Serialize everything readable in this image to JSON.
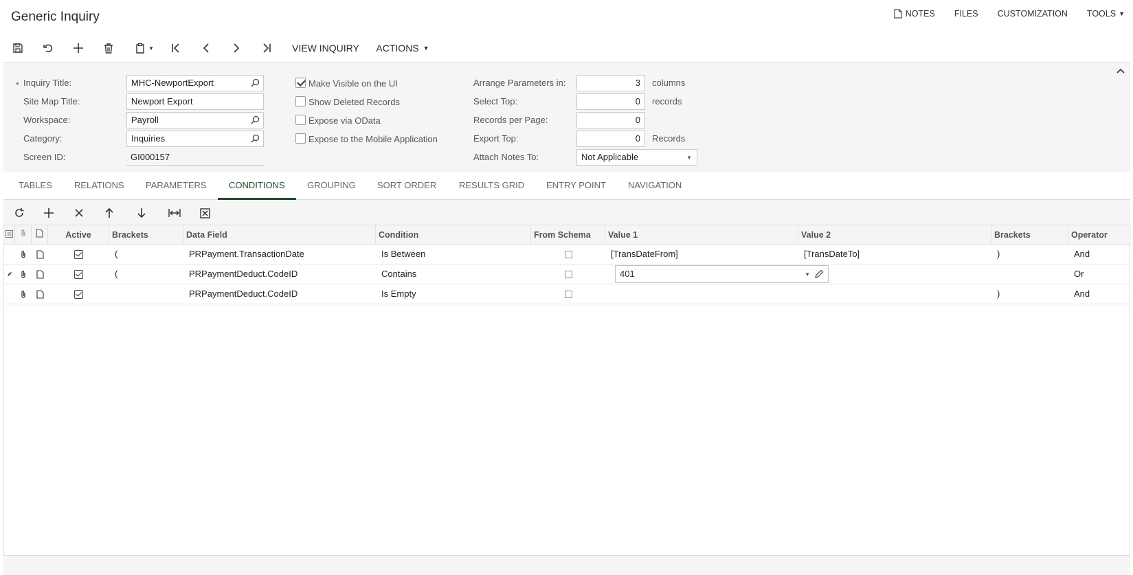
{
  "page": {
    "title": "Generic Inquiry"
  },
  "top_links": {
    "notes": "NOTES",
    "files": "FILES",
    "customization": "CUSTOMIZATION",
    "tools": "TOOLS"
  },
  "toolbar": {
    "view_inquiry": "VIEW INQUIRY",
    "actions": "ACTIONS",
    "icons": [
      "save-icon",
      "undo-icon",
      "add-icon",
      "delete-icon",
      "clipboard-icon",
      "first-record-icon",
      "previous-record-icon",
      "next-record-icon",
      "last-record-icon"
    ]
  },
  "form": {
    "required_mark": "*",
    "inquiry_title_label": "Inquiry Title:",
    "inquiry_title_value": "MHC-NewportExport",
    "site_map_title_label": "Site Map Title:",
    "site_map_title_value": "Newport Export",
    "workspace_label": "Workspace:",
    "workspace_value": "Payroll",
    "category_label": "Category:",
    "category_value": "Inquiries",
    "screen_id_label": "Screen ID:",
    "screen_id_value": "GI000157",
    "make_visible_label": "Make Visible on the UI",
    "make_visible_checked": true,
    "show_deleted_label": "Show Deleted Records",
    "show_deleted_checked": false,
    "expose_odata_label": "Expose via OData",
    "expose_odata_checked": false,
    "expose_mobile_label": "Expose to the Mobile Application",
    "expose_mobile_checked": false,
    "arrange_params_label": "Arrange Parameters in:",
    "arrange_params_value": "3",
    "arrange_params_unit": "columns",
    "select_top_label": "Select Top:",
    "select_top_value": "0",
    "select_top_unit": "records",
    "records_per_page_label": "Records per Page:",
    "records_per_page_value": "0",
    "export_top_label": "Export Top:",
    "export_top_value": "0",
    "export_top_unit": "Records",
    "attach_notes_label": "Attach Notes To:",
    "attach_notes_value": "Not Applicable"
  },
  "tabs": [
    {
      "label": "TABLES",
      "active": false
    },
    {
      "label": "RELATIONS",
      "active": false
    },
    {
      "label": "PARAMETERS",
      "active": false
    },
    {
      "label": "CONDITIONS",
      "active": true
    },
    {
      "label": "GROUPING",
      "active": false
    },
    {
      "label": "SORT ORDER",
      "active": false
    },
    {
      "label": "RESULTS GRID",
      "active": false
    },
    {
      "label": "ENTRY POINT",
      "active": false
    },
    {
      "label": "NAVIGATION",
      "active": false
    }
  ],
  "grid_toolbar": {
    "icons": [
      "refresh-icon",
      "add-row-icon",
      "delete-row-icon",
      "move-up-icon",
      "move-down-icon",
      "fit-columns-icon",
      "export-excel-icon"
    ]
  },
  "grid": {
    "columns": {
      "active": "Active",
      "brackets_open": "Brackets",
      "data_field": "Data Field",
      "condition": "Condition",
      "from_schema": "From Schema",
      "value1": "Value 1",
      "value2": "Value 2",
      "brackets_close": "Brackets",
      "operator": "Operator"
    },
    "rows": [
      {
        "active": true,
        "brackets_open": "(",
        "data_field": "PRPayment.TransactionDate",
        "condition": "Is Between",
        "from_schema": false,
        "value1": "[TransDateFrom]",
        "value2": "[TransDateTo]",
        "brackets_close": ")",
        "operator": "And"
      },
      {
        "active": true,
        "brackets_open": "(",
        "data_field": "PRPaymentDeduct.CodeID",
        "condition": "Contains",
        "from_schema": false,
        "value1": "401",
        "value2": "",
        "brackets_close": "",
        "operator": "Or"
      },
      {
        "active": true,
        "brackets_open": "",
        "data_field": "PRPaymentDeduct.CodeID",
        "condition": "Is Empty",
        "from_schema": false,
        "value1": "",
        "value2": "",
        "brackets_close": ")",
        "operator": "And"
      }
    ]
  },
  "colors": {
    "accent": "#1e4d2b",
    "panel_bg": "#f5f5f5",
    "border": "#c9c9c9"
  }
}
